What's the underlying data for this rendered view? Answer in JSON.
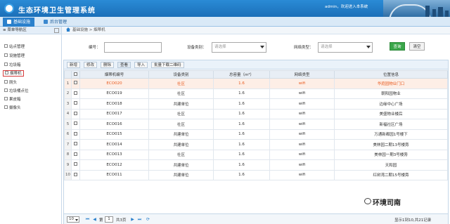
{
  "header": {
    "app_title": "生态环境卫生管理系统",
    "welcome": "admin，欢迎进入本系统"
  },
  "top_nav": {
    "tabs": [
      {
        "label": "基础设施",
        "active": true
      },
      {
        "label": "后台管理",
        "active": false
      }
    ]
  },
  "sidebar": {
    "title": "菜单导航区",
    "items": [
      {
        "label": "站点管理"
      },
      {
        "label": "设施管理"
      },
      {
        "label": "垃圾箱"
      },
      {
        "label": "烟蒂机",
        "selected": true
      },
      {
        "label": "厕头"
      },
      {
        "label": "垃圾桶点位"
      },
      {
        "label": "果皮箱"
      },
      {
        "label": "摄像头"
      }
    ]
  },
  "breadcrumb": "基础设施 > 烟蒂机",
  "search": {
    "code_label": "编号：",
    "code_value": "",
    "type_label": "设备类别：",
    "type_placeholder": "请选择",
    "net_label": "网络类型：",
    "net_placeholder": "请选择",
    "query_label": "查询",
    "clear_label": "清空"
  },
  "toolbar": [
    "新增",
    "修改",
    "删除",
    "查看",
    "导入",
    "批量下载二维码"
  ],
  "table": {
    "columns": [
      "",
      "",
      "烟蒂机编号",
      "设备类别",
      "总容量（m³）",
      "网络类型",
      "位置信息"
    ],
    "rows": [
      {
        "no": "1",
        "code": "ECO020",
        "type": "社区",
        "capacity": "1.6",
        "net": "wifi",
        "location": "华庭园物业门口",
        "highlight": true
      },
      {
        "no": "2",
        "code": "ECO019",
        "type": "社区",
        "capacity": "1.6",
        "net": "wifi",
        "location": "朝阳园物业"
      },
      {
        "no": "3",
        "code": "ECO018",
        "type": "共建单位",
        "capacity": "1.6",
        "net": "wifi",
        "location": "边缘中心广场"
      },
      {
        "no": "4",
        "code": "ECO017",
        "type": "社区",
        "capacity": "1.6",
        "net": "wifi",
        "location": "美盛物业楼后"
      },
      {
        "no": "5",
        "code": "ECO016",
        "type": "社区",
        "capacity": "1.6",
        "net": "wifi",
        "location": "新福社区广场"
      },
      {
        "no": "6",
        "code": "ECO015",
        "type": "共建单位",
        "capacity": "1.6",
        "net": "wifi",
        "location": "万通新都园1号楼下"
      },
      {
        "no": "7",
        "code": "ECO014",
        "type": "共建单位",
        "capacity": "1.6",
        "net": "wifi",
        "location": "美林园二期13号楼旁"
      },
      {
        "no": "8",
        "code": "ECO013",
        "type": "社区",
        "capacity": "1.6",
        "net": "wifi",
        "location": "美林园一期3号楼旁"
      },
      {
        "no": "9",
        "code": "ECO012",
        "type": "共建单位",
        "capacity": "1.6",
        "net": "wifi",
        "location": "天和园"
      },
      {
        "no": "10",
        "code": "ECO011",
        "type": "共建单位",
        "capacity": "1.6",
        "net": "wifi",
        "location": "红树湾二期15号楼旁"
      }
    ]
  },
  "pager": {
    "page_size": "10",
    "page_label": "第",
    "page_value": "1",
    "total_pages": "共3页",
    "summary": "显示1到10,共21记录"
  },
  "watermark": "环境司南"
}
